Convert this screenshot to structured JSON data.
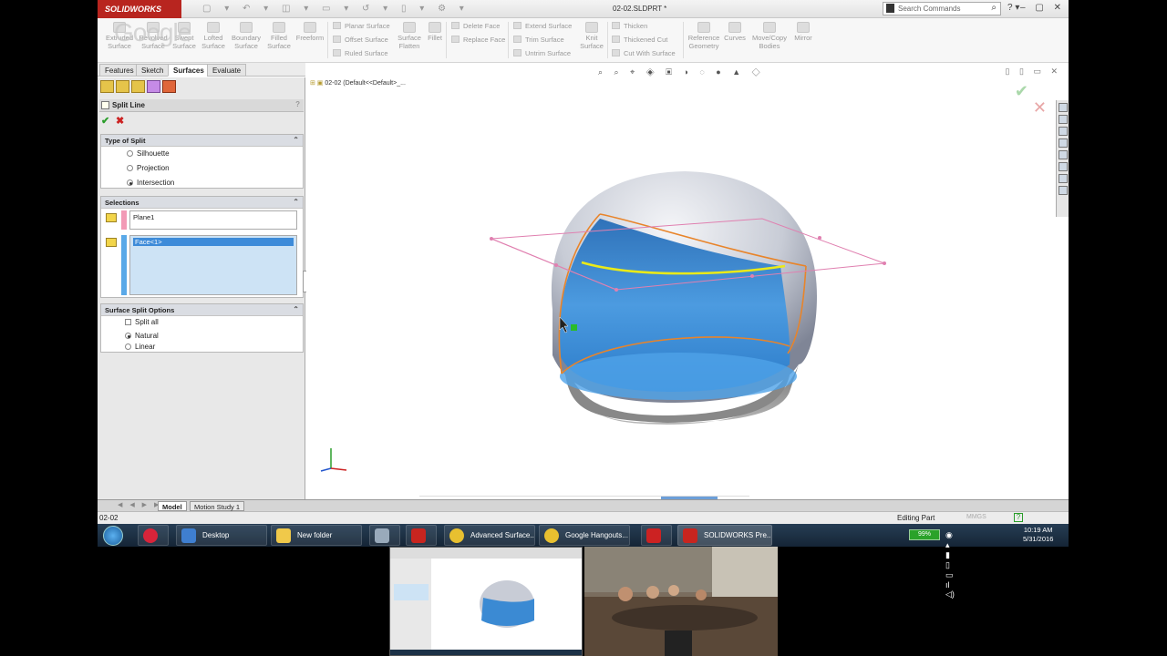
{
  "app": {
    "brand": "SOLIDWORKS",
    "doc_title": "02-02.SLDPRT *",
    "search_placeholder": "Search Commands"
  },
  "overlay": {
    "google_wordmark": "Google"
  },
  "ribbon": {
    "buttons": [
      {
        "label": "Extruded Surface",
        "icon": "extrude-surface-icon"
      },
      {
        "label": "Revolved Surface",
        "icon": "revolve-surface-icon"
      },
      {
        "label": "Swept Surface",
        "icon": "sweep-surface-icon"
      },
      {
        "label": "Lofted Surface",
        "icon": "loft-surface-icon"
      },
      {
        "label": "Boundary Surface",
        "icon": "boundary-surface-icon"
      },
      {
        "label": "Filled Surface",
        "icon": "filled-surface-icon"
      },
      {
        "label": "Freeform",
        "icon": "freeform-icon"
      }
    ],
    "col1": [
      "Planar Surface",
      "Offset Surface",
      "Ruled Surface"
    ],
    "flatten": "Surface Flatten",
    "fillet": "Fillet",
    "col2": [
      "Delete Face",
      "Replace Face"
    ],
    "col3": [
      "Extend Surface",
      "Trim Surface",
      "Untrim Surface"
    ],
    "knit": "Knit Surface",
    "col4": [
      "Thicken",
      "Thickened Cut",
      "Cut With Surface"
    ],
    "ref_geom": "Reference Geometry",
    "curves": "Curves",
    "move_copy": "Move/Copy Bodies",
    "mirror": "Mirror"
  },
  "tabs": [
    "Features",
    "Sketch",
    "Surfaces",
    "Evaluate"
  ],
  "property_manager": {
    "title": "Split Line",
    "type_group": {
      "title": "Type of Split",
      "options": [
        "Silhouette",
        "Projection",
        "Intersection"
      ],
      "selected": "Intersection"
    },
    "selections": {
      "title": "Selections",
      "plane": "Plane1",
      "face": "Face<1>"
    },
    "options_group": {
      "title": "Surface Split Options",
      "split_all": "Split all",
      "natural": "Natural",
      "linear": "Linear",
      "selected": "Natural"
    }
  },
  "viewport": {
    "tree_path": "02-02  (Default<<Default>_..."
  },
  "bottom_tabs": [
    "Model",
    "Motion Study 1"
  ],
  "status": {
    "left": "02-02",
    "mode": "Editing Part",
    "units": "MMGS"
  },
  "taskbar": {
    "items": [
      {
        "label": "Desktop"
      },
      {
        "label": "New folder"
      },
      {
        "label": "Advanced Surface..."
      },
      {
        "label": "Google Hangouts..."
      },
      {
        "label": "SOLIDWORKS Pre..."
      }
    ],
    "battery": "99%",
    "time": "10:19 AM",
    "date": "5/31/2016"
  },
  "colors": {
    "brand": "#b8251f",
    "shell": "#2f82c8",
    "orange": "#e8842a",
    "pink": "#e080b0",
    "yellow": "#e8e820",
    "taskbar": "#1c3147"
  }
}
